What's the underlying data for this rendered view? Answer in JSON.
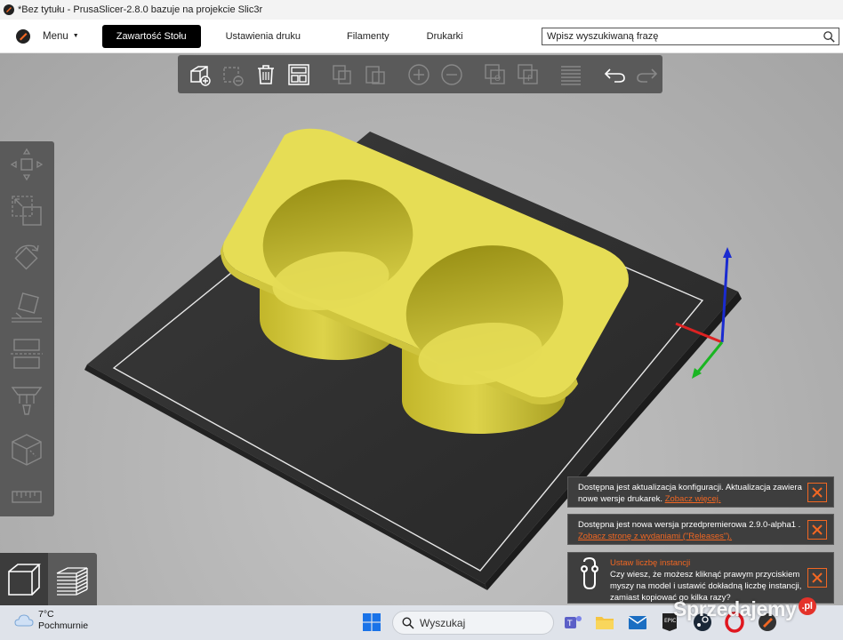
{
  "window": {
    "title": "*Bez tytułu - PrusaSlicer-2.8.0 bazuje na projekcie Slic3r"
  },
  "menubar": {
    "menu_label": "Menu",
    "tabs": [
      {
        "label": "Zawartość Stołu",
        "active": true
      },
      {
        "label": "Ustawienia druku",
        "active": false
      },
      {
        "label": "Filamenty",
        "active": false
      },
      {
        "label": "Drukarki",
        "active": false
      }
    ],
    "search": {
      "placeholder": "Wpisz wyszukiwaną frazę"
    }
  },
  "top_toolbar": {
    "icons": [
      "add-icon",
      "delete-icon",
      "delete-all-icon",
      "arrange-icon",
      "copy-icon",
      "paste-icon",
      "add-instance-icon",
      "remove-instance-icon",
      "split-objects-icon",
      "split-parts-icon",
      "layers-icon",
      "undo-icon",
      "redo-icon"
    ]
  },
  "left_toolbar": {
    "icons": [
      "move-icon",
      "scale-icon",
      "rotate-icon",
      "place-on-face-icon",
      "cut-icon",
      "paint-supports-icon",
      "seam-icon",
      "measure-icon"
    ]
  },
  "view_switch": {
    "icons": [
      "3d-view-icon",
      "preview-icon"
    ]
  },
  "notifications": [
    {
      "text": "Dostępna jest aktualizacja konfiguracji. Aktualizacja zawiera nowe wersje drukarek.",
      "link": "Zobacz więcej."
    },
    {
      "text": "Dostępna jest nowa wersja przedpremierowa 2.9.0-alpha1 .",
      "link": "Zobacz stronę z wydaniami (\"Releases\")."
    },
    {
      "title": "Ustaw liczbę instancji",
      "text": "Czy wiesz, że możesz kliknąć prawym przyciskiem myszy na model i ustawić dokładną liczbę instancji, zamiast kopiować go kilka razy?"
    }
  ],
  "taskbar": {
    "weather_temp": "7°C",
    "weather_desc": "Pochmurnie",
    "search_label": "Wyszukaj"
  },
  "watermark": {
    "text": "Sprzedajemy",
    "badge": ".pl"
  },
  "colors": {
    "accent": "#f26722",
    "model": "#e4dc55",
    "bed": "#303030",
    "toolbar": "#5a5a5a"
  }
}
